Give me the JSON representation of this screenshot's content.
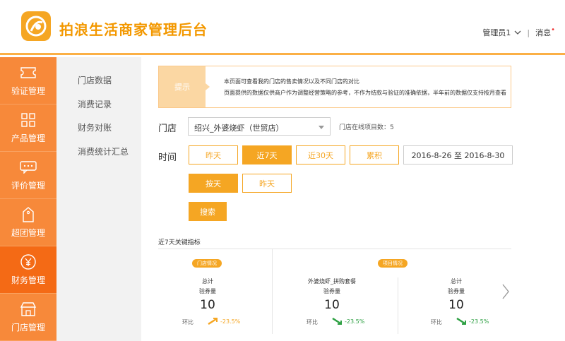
{
  "header": {
    "brand": "拍浪生活商家管理后台",
    "user": "管理员1",
    "messages": "消息"
  },
  "nav": [
    {
      "label": "验证管理",
      "icon": "ticket-icon"
    },
    {
      "label": "产品管理",
      "icon": "grid-icon"
    },
    {
      "label": "评价管理",
      "icon": "comment-icon"
    },
    {
      "label": "超团管理",
      "icon": "tag-icon"
    },
    {
      "label": "财务管理",
      "icon": "yen-icon",
      "active": true
    },
    {
      "label": "门店管理",
      "icon": "store-icon"
    }
  ],
  "subnav": [
    "门店数据",
    "消费记录",
    "财务对账",
    "消费统计汇总"
  ],
  "tip": {
    "label": "提示",
    "line1": "本页面可查看我的门店的售卖情况以及不同门店的对比",
    "line2": "页面提供的数据仅供商户作为调整经营策略的参考，不作为结款与验证的准确依据，半年前的数据仅支持按月查看"
  },
  "filters": {
    "store_label": "门店",
    "store_value": "绍兴_外婆烧虾（世贸店）",
    "store_count": "门店在线项目数：5",
    "time_label": "时间",
    "time_buttons": [
      "昨天",
      "近7天",
      "近30天",
      "累积"
    ],
    "date_range": "2016-8-26 至 2016-8-30",
    "granularity_buttons": [
      "按天",
      "昨天"
    ],
    "search": "搜索"
  },
  "kpi": {
    "title": "近7天关键指标",
    "store_badge": "门店情况",
    "project_badge": "项目情况",
    "cards": [
      {
        "name": "总计",
        "metric": "验券量",
        "value": "10",
        "cmp_label": "环比",
        "change": "-23.5%",
        "trend": "up"
      },
      {
        "name": "外婆烧虾_拼购套餐",
        "metric": "验券量",
        "value": "10",
        "cmp_label": "环比",
        "change": "-23.5%",
        "trend": "down"
      },
      {
        "name": "总计",
        "metric": "验券量",
        "value": "10",
        "cmp_label": "环比",
        "change": "-23.5%",
        "trend": "down"
      }
    ]
  },
  "colors": {
    "accent": "#f5a623",
    "nav_bg": "#f7893a",
    "nav_active": "#f46a15",
    "up": "#f5a623",
    "down": "#2ea043"
  }
}
